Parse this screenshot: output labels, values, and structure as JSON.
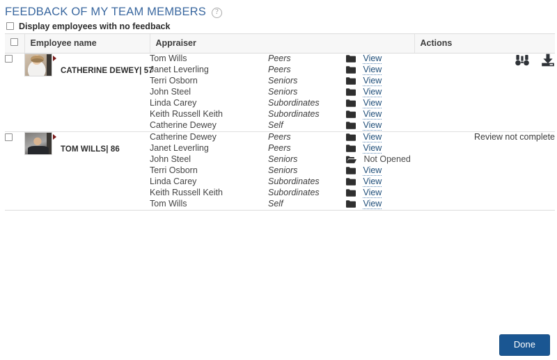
{
  "header": {
    "title": "FEEDBACK OF MY TEAM MEMBERS",
    "help_icon": "question-circle-icon",
    "title_color": "#39679f"
  },
  "filter": {
    "label": "Display employees with no feedback",
    "checked": false
  },
  "table": {
    "columns": {
      "select_all": "",
      "employee_name": "Employee name",
      "appraiser": "Appraiser",
      "actions": "Actions"
    },
    "groups": [
      {
        "employee": "CATHERINE DEWEY| 57",
        "avatar": "female-avatar",
        "selected": false,
        "status_note": "",
        "actions": [
          {
            "icon": "binoculars-icon",
            "label": ""
          },
          {
            "icon": "download-icon",
            "label": ""
          }
        ],
        "rows": [
          {
            "appraiser": "Tom Wills",
            "relation": "Peers",
            "doc_label": "View",
            "doc_icon": "folder-closed-icon",
            "opened": true
          },
          {
            "appraiser": "Janet Leverling",
            "relation": "Peers",
            "doc_label": "View",
            "doc_icon": "folder-closed-icon",
            "opened": true
          },
          {
            "appraiser": "Terri Osborn",
            "relation": "Seniors",
            "doc_label": "View",
            "doc_icon": "folder-closed-icon",
            "opened": true
          },
          {
            "appraiser": "John Steel",
            "relation": "Seniors",
            "doc_label": "View",
            "doc_icon": "folder-closed-icon",
            "opened": true
          },
          {
            "appraiser": "Linda Carey",
            "relation": "Subordinates",
            "doc_label": "View",
            "doc_icon": "folder-closed-icon",
            "opened": true
          },
          {
            "appraiser": "Keith Russell Keith",
            "relation": "Subordinates",
            "doc_label": "View",
            "doc_icon": "folder-closed-icon",
            "opened": true
          },
          {
            "appraiser": "Catherine Dewey",
            "relation": "Self",
            "doc_label": "View",
            "doc_icon": "folder-closed-icon",
            "opened": true
          }
        ]
      },
      {
        "employee": "TOM WILLS| 86",
        "avatar": "male-avatar",
        "selected": false,
        "status_note": "Review not complete",
        "actions": [],
        "rows": [
          {
            "appraiser": "Catherine Dewey",
            "relation": "Peers",
            "doc_label": "View",
            "doc_icon": "folder-closed-icon",
            "opened": true
          },
          {
            "appraiser": "Janet Leverling",
            "relation": "Peers",
            "doc_label": "View",
            "doc_icon": "folder-closed-icon",
            "opened": true
          },
          {
            "appraiser": "John Steel",
            "relation": "Seniors",
            "doc_label": "Not Opened",
            "doc_icon": "folder-open-icon",
            "opened": false
          },
          {
            "appraiser": "Terri Osborn",
            "relation": "Seniors",
            "doc_label": "View",
            "doc_icon": "folder-closed-icon",
            "opened": true
          },
          {
            "appraiser": "Linda Carey",
            "relation": "Subordinates",
            "doc_label": "View",
            "doc_icon": "folder-closed-icon",
            "opened": true
          },
          {
            "appraiser": "Keith Russell Keith",
            "relation": "Subordinates",
            "doc_label": "View",
            "doc_icon": "folder-closed-icon",
            "opened": true
          },
          {
            "appraiser": "Tom Wills",
            "relation": "Self",
            "doc_label": "View",
            "doc_icon": "folder-closed-icon",
            "opened": true
          }
        ]
      }
    ]
  },
  "footer": {
    "done_label": "Done",
    "done_color": "#1a5692"
  }
}
